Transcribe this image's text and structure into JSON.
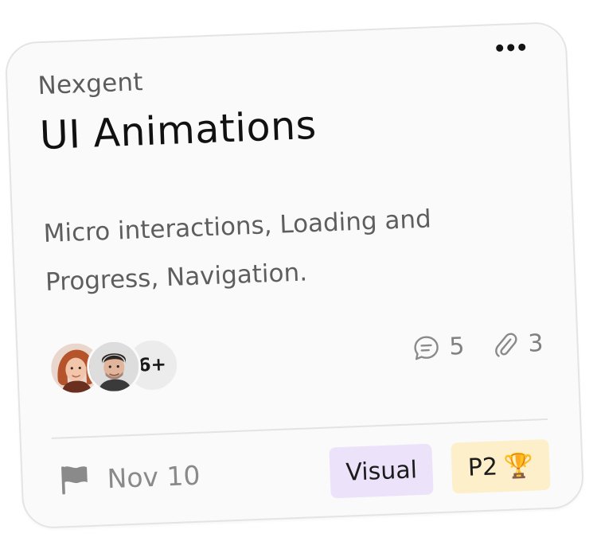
{
  "card": {
    "workspace": "Nexgent",
    "title": "UI Animations",
    "description": "Micro interactions, Loading and Progress, Navigation.",
    "more_icon": "ellipsis-horizontal-icon",
    "assignees": {
      "avatars": [
        {
          "name_icon": "avatar-red-hair-woman"
        },
        {
          "name_icon": "avatar-dark-hair-man"
        }
      ],
      "more_count": "6+"
    },
    "stats": {
      "comments": {
        "icon": "chat-bubble-icon",
        "count": "5"
      },
      "attachments": {
        "icon": "paperclip-icon",
        "count": "3"
      }
    },
    "due": {
      "icon": "flag-icon",
      "date": "Nov 10"
    },
    "tags": [
      {
        "label": "Visual",
        "bg": "#ece3fb"
      },
      {
        "label": "P2",
        "emoji": "🏆",
        "bg": "#fdefc9"
      }
    ]
  },
  "colors": {
    "card_bg": "#fafafa",
    "card_border": "#e4e4e4",
    "title": "#111111",
    "muted": "#5e5e5e",
    "visual_tag": "#ece3fb",
    "priority_tag": "#fdefc9"
  }
}
